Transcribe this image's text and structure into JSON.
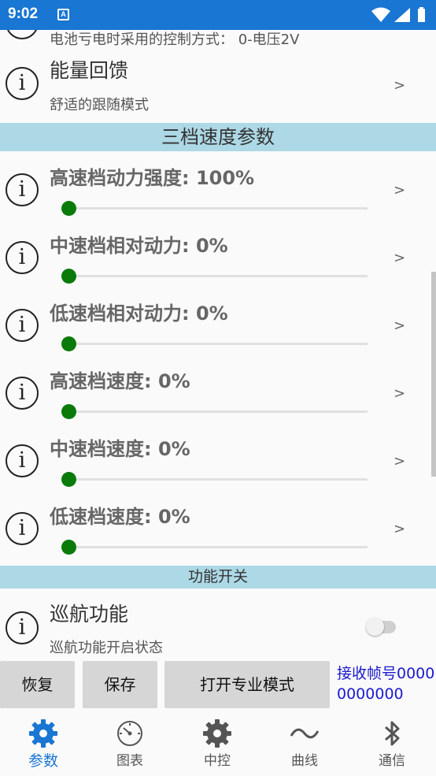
{
  "status_bar": {
    "time": "9:02",
    "notification_icon": "A"
  },
  "partial_row": {
    "text": "电池亏电时采用的控制方式： 0-电压2V"
  },
  "energy_row": {
    "title": "能量回馈",
    "subtitle": "舒适的跟随模式",
    "chevron": ">"
  },
  "section_speed": {
    "title": "三档速度参数"
  },
  "sliders": [
    {
      "title": "高速档动力强度: 100%",
      "value_percent": 100,
      "chevron": ">"
    },
    {
      "title": "中速档相对动力: 0%",
      "value_percent": 0,
      "chevron": ">"
    },
    {
      "title": "低速档相对动力: 0%",
      "value_percent": 0,
      "chevron": ">"
    },
    {
      "title": "高速档速度: 0%",
      "value_percent": 0,
      "chevron": ">"
    },
    {
      "title": "中速档速度: 0%",
      "value_percent": 0,
      "chevron": ">"
    },
    {
      "title": "低速档速度: 0%",
      "value_percent": 0,
      "chevron": ">"
    }
  ],
  "section_function": {
    "title": "功能开关"
  },
  "cruise_row": {
    "title": "巡航功能",
    "subtitle": "巡航功能开启状态",
    "enabled": false
  },
  "buttons": {
    "restore": "恢复",
    "save": "保存",
    "pro_mode": "打开专业模式"
  },
  "receive_frame": {
    "text": "接收帧号00000000000"
  },
  "tabs": [
    {
      "label": "参数",
      "icon": "gear-icon",
      "active": true
    },
    {
      "label": "图表",
      "icon": "gauge-icon",
      "active": false
    },
    {
      "label": "中控",
      "icon": "gear-icon",
      "active": false
    },
    {
      "label": "曲线",
      "icon": "wave-icon",
      "active": false
    },
    {
      "label": "通信",
      "icon": "bluetooth-icon",
      "active": false
    }
  ],
  "colors": {
    "status_bar": "#1976d2",
    "section_header": "#add8e6",
    "slider_thumb": "#0a7a0a",
    "active_tab": "#1976d2",
    "receive_text": "#1a1ad0"
  }
}
